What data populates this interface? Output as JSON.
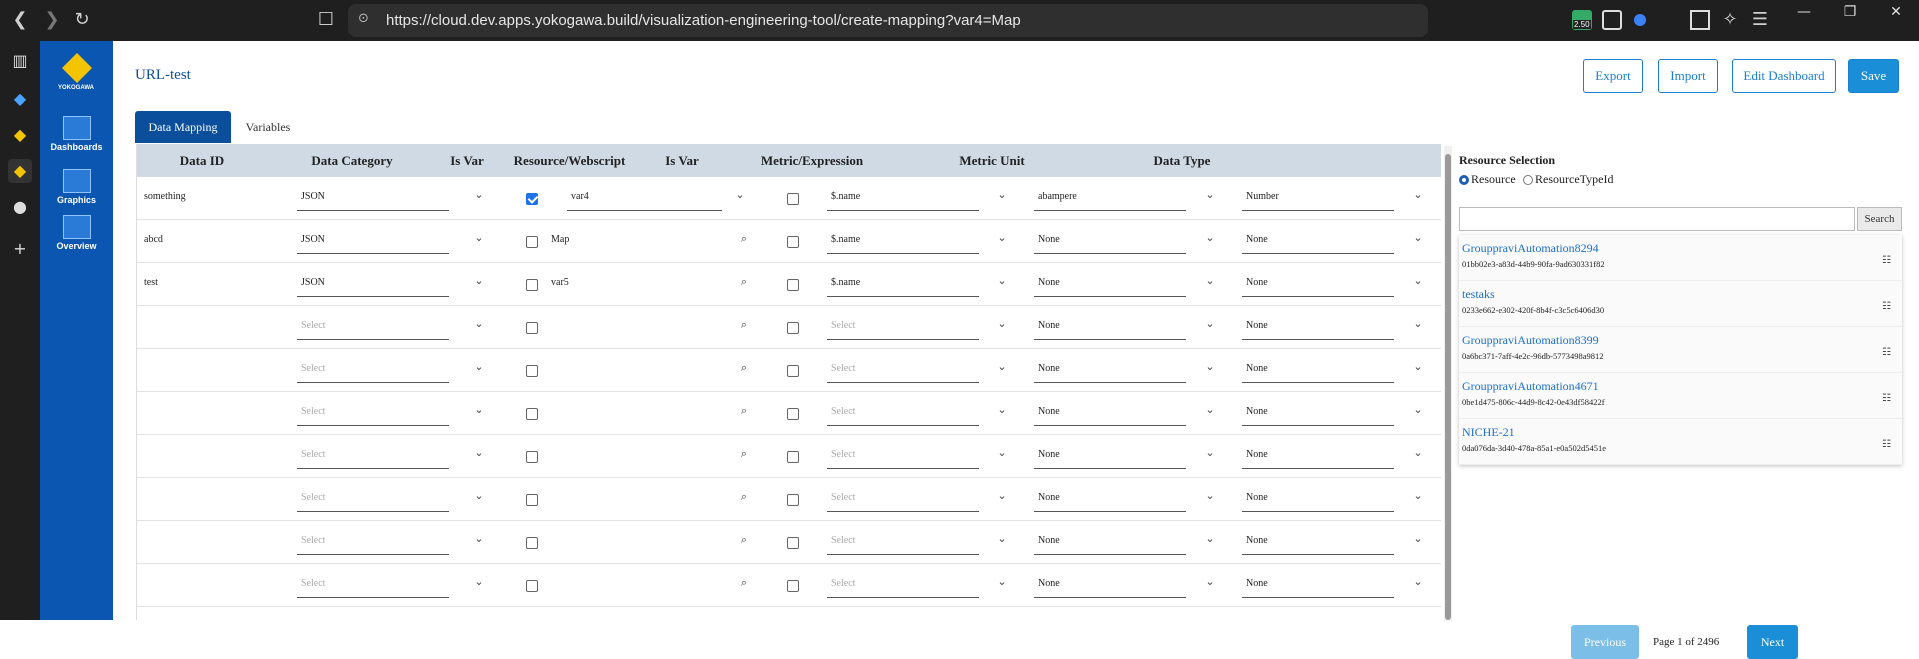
{
  "browser": {
    "url": "https://cloud.dev.apps.yokogawa.build/visualization-engineering-tool/create-mapping?var4=Map",
    "extension_badge": "2.50"
  },
  "app": {
    "logo_text": "YOKOGAWA",
    "nav": [
      {
        "label": "Dashboards",
        "icon": "dashboards-icon"
      },
      {
        "label": "Graphics",
        "icon": "graphics-icon"
      },
      {
        "label": "Overview",
        "icon": "overview-icon"
      }
    ]
  },
  "page": {
    "title": "URL-test",
    "buttons": {
      "export": "Export",
      "import": "Import",
      "edit_dashboard": "Edit Dashboard",
      "save": "Save"
    },
    "tabs": [
      {
        "label": "Data Mapping",
        "active": true
      },
      {
        "label": "Variables",
        "active": false
      }
    ]
  },
  "grid": {
    "headers": [
      "Data ID",
      "Data Category",
      "Is Var",
      "Resource/Webscript",
      "Is Var",
      "Metric/Expression",
      "Metric Unit",
      "Data Type"
    ],
    "rows": [
      {
        "data_id": "something",
        "category": "JSON",
        "is_var1": true,
        "resource": "var4",
        "is_var2": false,
        "metric": "$.name",
        "unit": "abampere",
        "type": "Number"
      },
      {
        "data_id": "abcd",
        "category": "JSON",
        "is_var1": false,
        "resource": "Map",
        "is_var2": false,
        "metric": "$.name",
        "unit": "None",
        "type": "None"
      },
      {
        "data_id": "test",
        "category": "JSON",
        "is_var1": false,
        "resource": "var5",
        "is_var2": false,
        "metric": "$.name",
        "unit": "None",
        "type": "None"
      },
      {
        "data_id": "",
        "category": "Select",
        "is_var1": false,
        "resource": "",
        "is_var2": false,
        "metric": "Select",
        "unit": "None",
        "type": "None"
      },
      {
        "data_id": "",
        "category": "Select",
        "is_var1": false,
        "resource": "",
        "is_var2": false,
        "metric": "Select",
        "unit": "None",
        "type": "None"
      },
      {
        "data_id": "",
        "category": "Select",
        "is_var1": false,
        "resource": "",
        "is_var2": false,
        "metric": "Select",
        "unit": "None",
        "type": "None"
      },
      {
        "data_id": "",
        "category": "Select",
        "is_var1": false,
        "resource": "",
        "is_var2": false,
        "metric": "Select",
        "unit": "None",
        "type": "None"
      },
      {
        "data_id": "",
        "category": "Select",
        "is_var1": false,
        "resource": "",
        "is_var2": false,
        "metric": "Select",
        "unit": "None",
        "type": "None"
      },
      {
        "data_id": "",
        "category": "Select",
        "is_var1": false,
        "resource": "",
        "is_var2": false,
        "metric": "Select",
        "unit": "None",
        "type": "None"
      },
      {
        "data_id": "",
        "category": "Select",
        "is_var1": false,
        "resource": "",
        "is_var2": false,
        "metric": "Select",
        "unit": "None",
        "type": "None"
      }
    ]
  },
  "resource_panel": {
    "title": "Resource Selection",
    "radio_resource": "Resource",
    "radio_type": "ResourceTypeId",
    "search_button": "Search",
    "items": [
      {
        "name": "GrouppraviAutomation8294",
        "id": "01bb02e3-a83d-44b9-90fa-9ad630331f82"
      },
      {
        "name": "testaks",
        "id": "0233e662-e302-420f-8b4f-c3c5c6406d30"
      },
      {
        "name": "GrouppraviAutomation8399",
        "id": "0a6bc371-7aff-4e2c-96db-5773498a9812"
      },
      {
        "name": "GrouppraviAutomation4671",
        "id": "0be1d475-806c-44d9-8c42-0e43df58422f"
      },
      {
        "name": "NICHE-21",
        "id": "0da076da-3d40-478a-85a1-e0a502d5451e"
      }
    ],
    "pager": {
      "previous": "Previous",
      "status": "Page 1 of 2496",
      "next": "Next"
    }
  }
}
